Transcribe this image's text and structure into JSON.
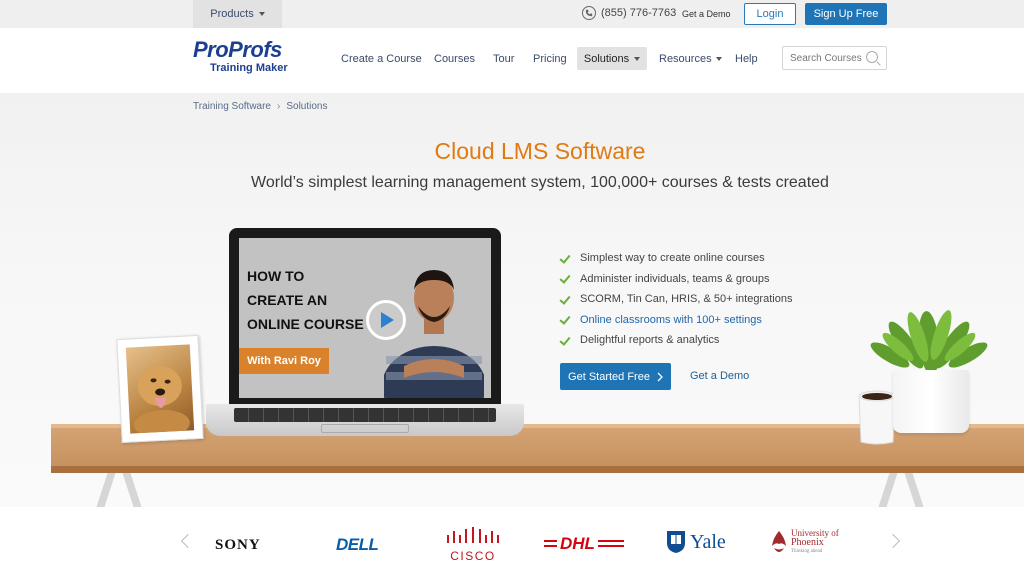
{
  "topbar": {
    "products_label": "Products",
    "phone": "(855) 776-7763",
    "get_demo": "Get a Demo",
    "login": "Login",
    "signup": "Sign Up Free"
  },
  "header": {
    "logo_main": "ProProfs",
    "logo_sub": "Training Maker",
    "nav": {
      "create_course": "Create a Course",
      "courses": "Courses",
      "tour": "Tour",
      "pricing": "Pricing",
      "solutions": "Solutions",
      "resources": "Resources",
      "help": "Help"
    },
    "search_placeholder": "Search Courses"
  },
  "breadcrumb": {
    "items": [
      "Training Software",
      "Solutions"
    ],
    "separator": "›"
  },
  "hero": {
    "title": "Cloud LMS Software",
    "subtitle": "World’s simplest learning management system, 100,000+ courses & tests created",
    "video": {
      "course_text": "HOW TO\nCREATE AN\nONLINE COURSE",
      "presenter_tag": "With Ravi Roy"
    },
    "features": [
      "Simplest way to create online courses",
      "Administer individuals, teams & groups",
      "SCORM, Tin Can, HRIS, & 50+ integrations",
      "Online classrooms with 100+ settings",
      "Delightful reports & analytics"
    ],
    "cta_primary": "Get Started Free",
    "cta_secondary": "Get a Demo"
  },
  "logos": {
    "sony": "SONY",
    "dell": "DELL",
    "cisco": "CISCO",
    "dhl": "DHL",
    "yale": "Yale",
    "phoenix_line1": "University of",
    "phoenix_line2": "Phoenix",
    "phoenix_tag": "Thinking ahead"
  },
  "colors": {
    "accent_orange": "#e07a12",
    "primary_blue": "#1f74b6",
    "check_green": "#6aad3b",
    "logo_blue": "#1d3f8f"
  }
}
